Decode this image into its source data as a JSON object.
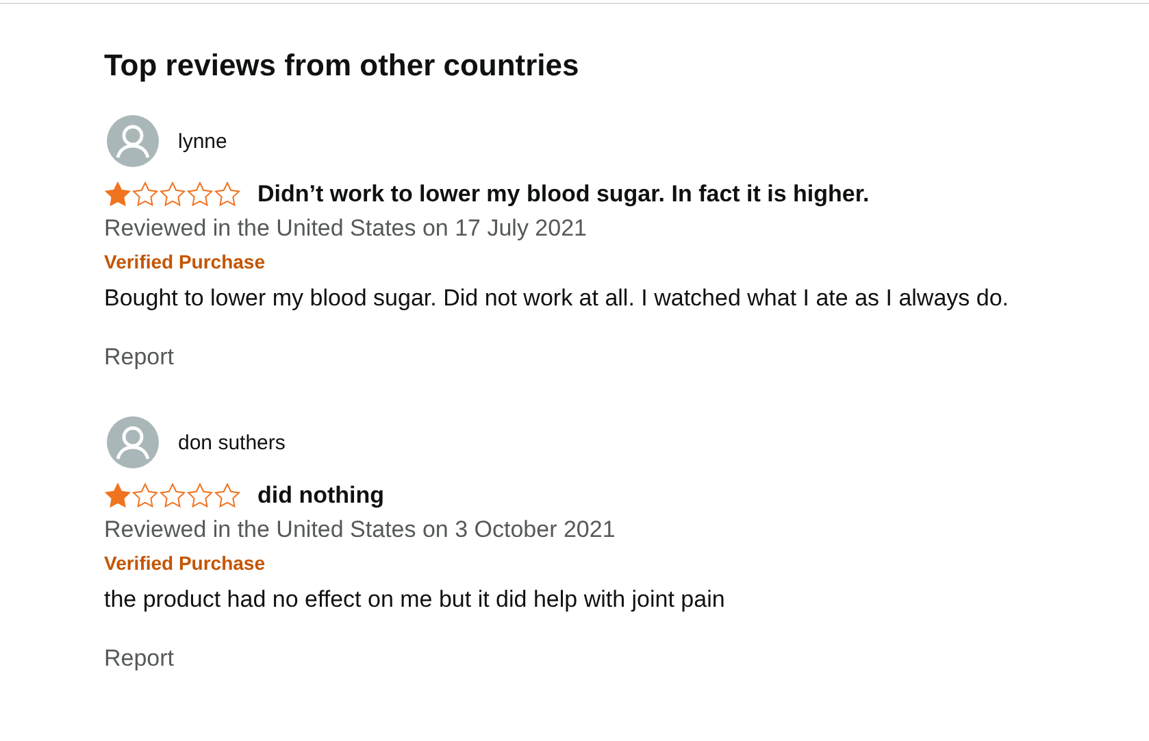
{
  "heading": "Top reviews from other countries",
  "reviews": [
    {
      "author": "lynne",
      "stars": 1,
      "title": "Didn’t work to lower my blood sugar. In fact it is higher.",
      "meta": "Reviewed in the United States on 17 July 2021",
      "badge": "Verified Purchase",
      "body": "Bought to lower my blood sugar. Did not work at all. I watched what I ate as I always do.",
      "report": "Report"
    },
    {
      "author": "don suthers",
      "stars": 1,
      "title": "did nothing",
      "meta": "Reviewed in the United States on 3 October 2021",
      "badge": "Verified Purchase",
      "body": "the product had no effect on me but it did help with joint pain",
      "report": "Report"
    }
  ]
}
